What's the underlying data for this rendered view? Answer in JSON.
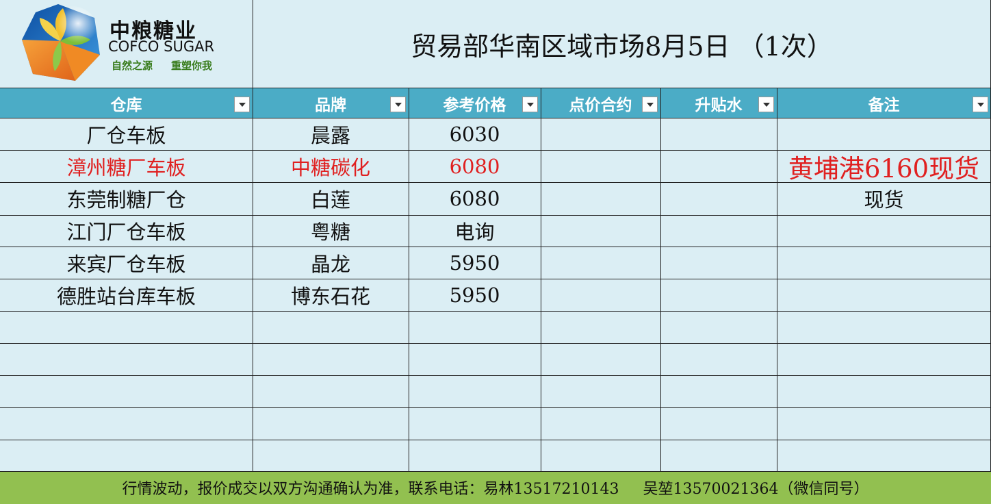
{
  "logo": {
    "name_cn": "中粮糖业",
    "name_en": "COFCO SUGAR",
    "slogan_left": "自然之源",
    "slogan_right": "重塑你我",
    "colors": {
      "blue": "#1a73c7",
      "yellow": "#f2c12e",
      "green": "#7cbf3a",
      "orange": "#f08a24",
      "slogan": "#3a7d1e"
    }
  },
  "title": "贸易部华南区域市场8月5日  （1次）",
  "columns": [
    "仓库",
    "品牌",
    "参考价格",
    "点价合约",
    "升贴水",
    "备注"
  ],
  "rows": [
    {
      "warehouse": "厂仓车板",
      "brand": "晨露",
      "price": "6030",
      "contract": "",
      "basis": "",
      "note": "",
      "highlight": false
    },
    {
      "warehouse": "漳州糖厂车板",
      "brand": "中糖碳化",
      "price": "6080",
      "contract": "",
      "basis": "",
      "note": "黄埔港6160现货",
      "highlight": true
    },
    {
      "warehouse": "东莞制糖厂仓",
      "brand": "白莲",
      "price": "6080",
      "contract": "",
      "basis": "",
      "note": "现货",
      "highlight": false
    },
    {
      "warehouse": "江门厂仓车板",
      "brand": "粤糖",
      "price": "电询",
      "contract": "",
      "basis": "",
      "note": "",
      "highlight": false
    },
    {
      "warehouse": "来宾厂仓车板",
      "brand": "晶龙",
      "price": "5950",
      "contract": "",
      "basis": "",
      "note": "",
      "highlight": false
    },
    {
      "warehouse": "德胜站台库车板",
      "brand": "博东石花",
      "price": "5950",
      "contract": "",
      "basis": "",
      "note": "",
      "highlight": false
    },
    {
      "warehouse": "",
      "brand": "",
      "price": "",
      "contract": "",
      "basis": "",
      "note": "",
      "highlight": false
    },
    {
      "warehouse": "",
      "brand": "",
      "price": "",
      "contract": "",
      "basis": "",
      "note": "",
      "highlight": false
    },
    {
      "warehouse": "",
      "brand": "",
      "price": "",
      "contract": "",
      "basis": "",
      "note": "",
      "highlight": false
    },
    {
      "warehouse": "",
      "brand": "",
      "price": "",
      "contract": "",
      "basis": "",
      "note": "",
      "highlight": false
    },
    {
      "warehouse": "",
      "brand": "",
      "price": "",
      "contract": "",
      "basis": "",
      "note": "",
      "highlight": false
    }
  ],
  "footer": "行情波动，报价成交以双方沟通确认为准，联系电话：易林13517210143     吴堃13570021364（微信同号）",
  "colors": {
    "background": "#dbeef4",
    "header": "#4bacc6",
    "footer": "#92c050",
    "highlight_text": "#e02020"
  }
}
